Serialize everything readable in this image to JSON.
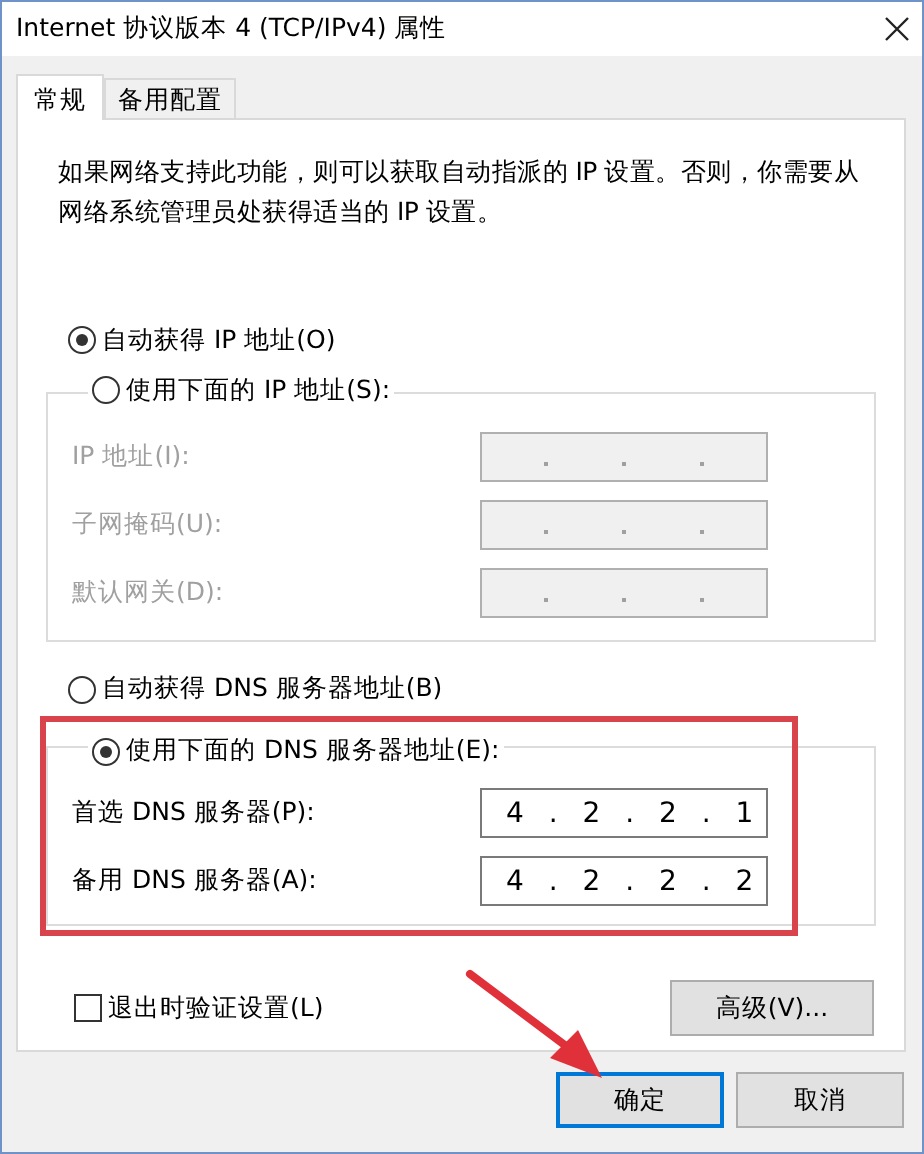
{
  "window": {
    "title": "Internet 协议版本 4 (TCP/IPv4) 属性"
  },
  "tabs": [
    {
      "label": "常规",
      "selected": true
    },
    {
      "label": "备用配置",
      "selected": false
    }
  ],
  "description": "如果网络支持此功能，则可以获取自动指派的 IP 设置。否则，你需要从网络系统管理员处获得适当的 IP 设置。",
  "ip_options": [
    {
      "label": "自动获得 IP 地址(O)",
      "selected": true
    },
    {
      "label": "使用下面的 IP 地址(S):",
      "selected": false
    }
  ],
  "ip_fields": [
    {
      "label": "IP 地址(I):",
      "disabled": true
    },
    {
      "label": "子网掩码(U):",
      "disabled": true
    },
    {
      "label": "默认网关(D):",
      "disabled": true
    }
  ],
  "dns_options": [
    {
      "label": "自动获得 DNS 服务器地址(B)",
      "selected": false
    },
    {
      "label": "使用下面的 DNS 服务器地址(E):",
      "selected": true
    }
  ],
  "dns_fields": [
    {
      "label": "首选 DNS 服务器(P):",
      "value": "4 . 2 . 2 . 1",
      "disabled": false
    },
    {
      "label": "备用 DNS 服务器(A):",
      "value": "4 . 2 . 2 . 2",
      "disabled": false
    }
  ],
  "validate_on_exit": {
    "label": "退出时验证设置(L)",
    "checked": false
  },
  "advanced_button": "高级(V)...",
  "buttons": [
    "确定",
    "取消"
  ]
}
